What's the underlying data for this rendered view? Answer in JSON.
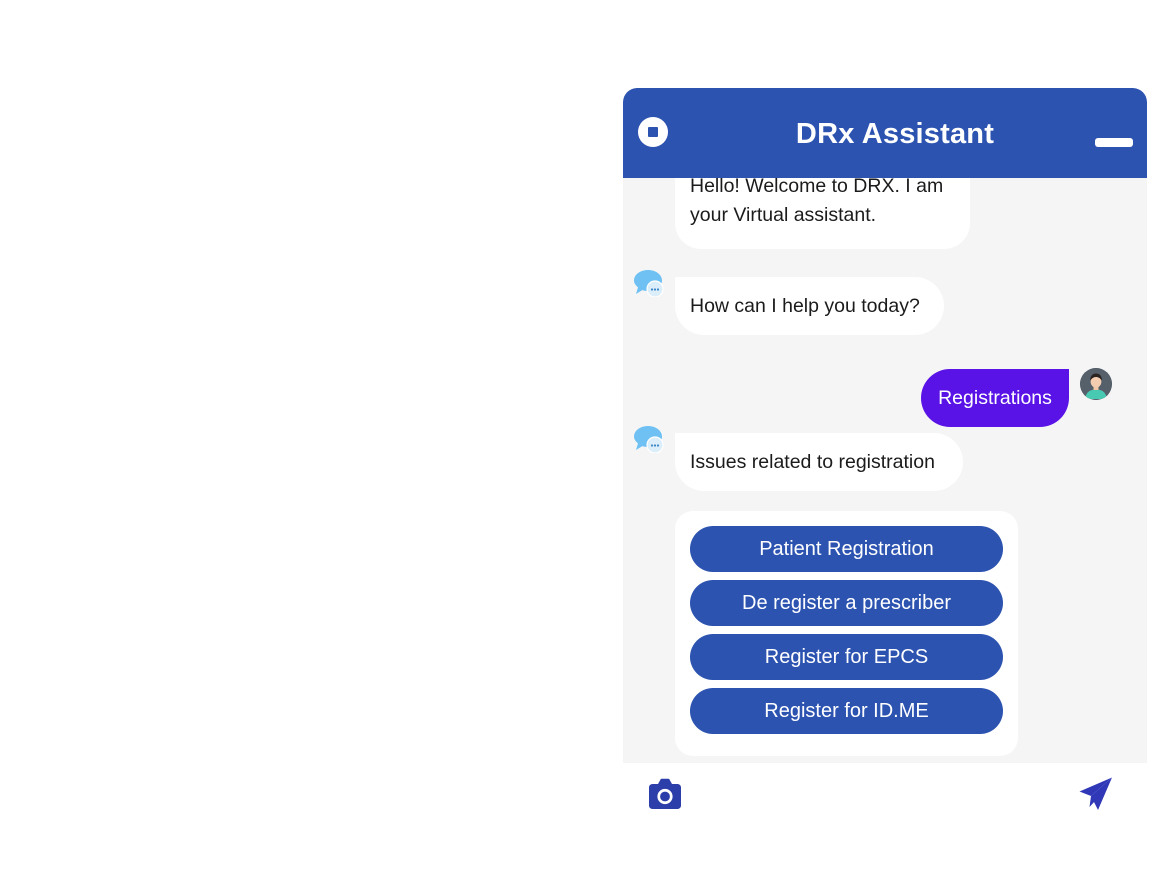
{
  "header": {
    "title": "DRx Assistant",
    "stop_icon": "stop-square-icon",
    "minimize_icon": "minimize-icon",
    "color": "#2c53b0"
  },
  "messages": [
    {
      "from": "bot",
      "text": "Hello! Welcome to DRX. I am your Virtual assistant.",
      "line1": "Hello! Welcome to DRX. I am",
      "line2": "your Virtual assistant."
    },
    {
      "from": "bot",
      "text": "How can I help you today?"
    },
    {
      "from": "user",
      "text": "Registrations"
    },
    {
      "from": "bot",
      "text": "Issues related to registration"
    }
  ],
  "options": [
    "Patient Registration",
    "De register a prescriber",
    "Register for EPCS",
    "Register for ID.ME"
  ],
  "footer": {
    "camera_icon": "camera-icon",
    "send_icon": "send-icon"
  },
  "colors": {
    "accent": "#2c53b0",
    "user_bubble": "#5a13e6",
    "background": "#f5f5f6"
  }
}
